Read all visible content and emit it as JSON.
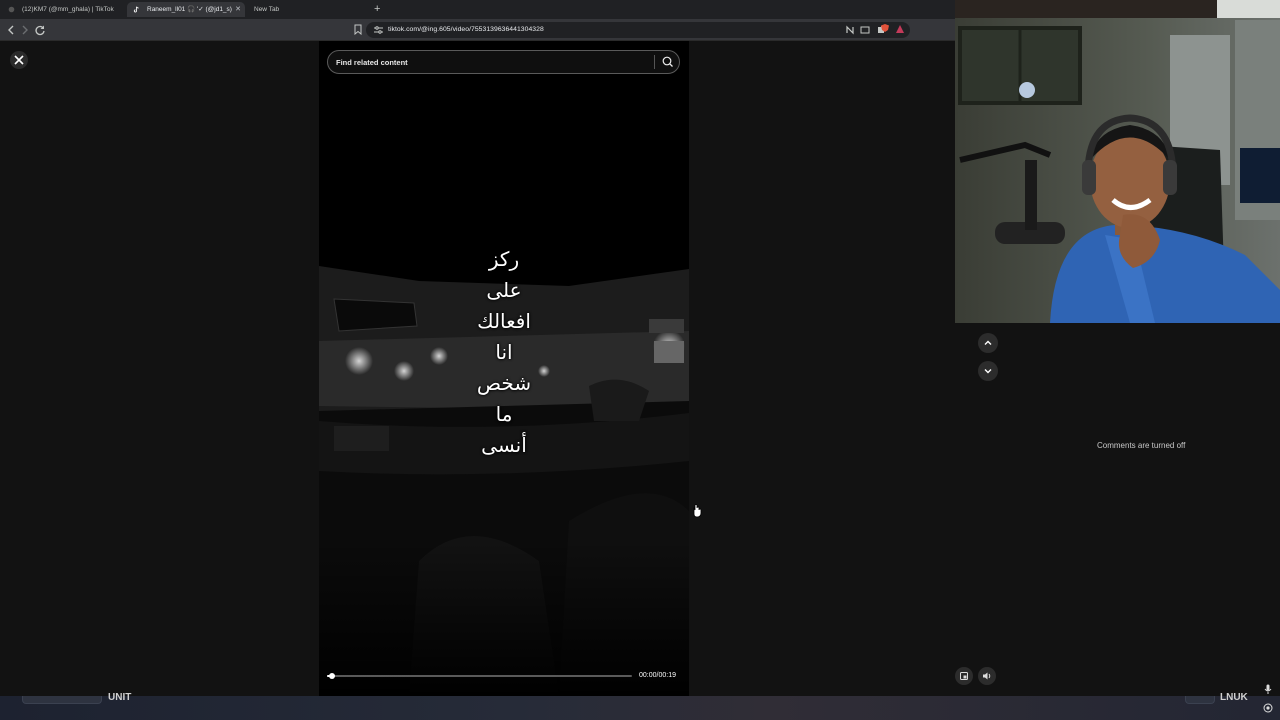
{
  "browser": {
    "tabs": [
      {
        "label": "(12)KM7 (@mm_ghala) | TikTok",
        "active": false
      },
      {
        "label": "Raneem_ll01 🎧 '✓ (@jd1_s)",
        "active": true
      },
      {
        "label": "New Tab",
        "active": false
      }
    ],
    "url": "tiktok.com/@ing.605/video/7553139636441304328"
  },
  "video": {
    "search_placeholder": "Find related content",
    "caption_lines": [
      "ركز",
      "على",
      "افعالك",
      "انا",
      "شخص",
      "ما",
      "أنسى"
    ],
    "time": "00:00/00:19",
    "progress_fraction": 0.01
  },
  "side_panel": {
    "comments_status": "Comments are turned off"
  },
  "taskbar": {
    "left_text": "UNIT",
    "right_text": "LNUK"
  },
  "icons": {
    "close": "close-icon",
    "search": "search-icon",
    "prev": "chevron-up-icon",
    "next": "chevron-down-icon",
    "volume": "volume-icon",
    "miniplayer": "miniplayer-icon"
  }
}
